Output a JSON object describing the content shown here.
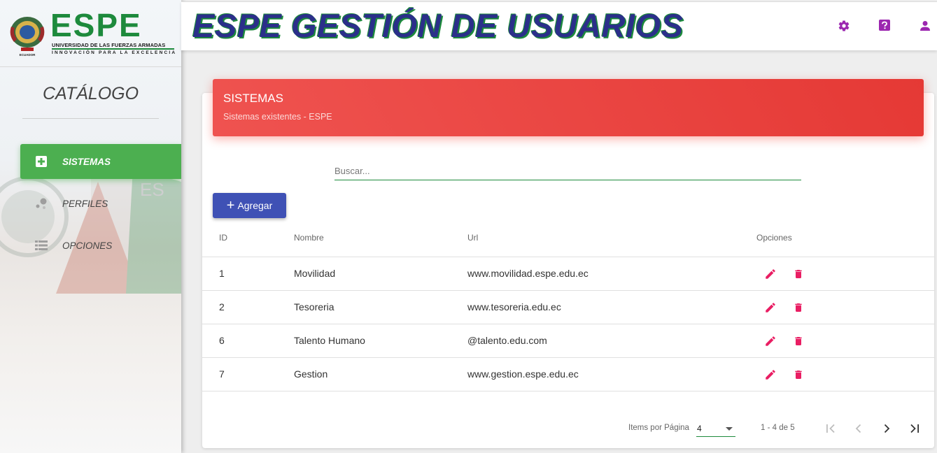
{
  "brand": {
    "logo_word": "ESPE",
    "logo_line1": "UNIVERSIDAD DE LAS FUERZAS ARMADAS",
    "logo_line2": "INNOVACIÓN PARA LA EXCELENCIA",
    "shield_text": "ECUADOR"
  },
  "header": {
    "title": "ESPE GESTIÓN DE USUARIOS",
    "icons": [
      "gear-icon",
      "help-icon",
      "user-icon"
    ]
  },
  "sidebar": {
    "section_title": "CATÁLOGO",
    "items": [
      {
        "label": "SISTEMAS",
        "icon": "plus-box-icon",
        "active": true
      },
      {
        "label": "PERFILES",
        "icon": "bubbles-icon",
        "active": false
      },
      {
        "label": "OPCIONES",
        "icon": "list-icon",
        "active": false
      }
    ]
  },
  "card": {
    "title": "SISTEMAS",
    "subtitle": "Sistemas existentes - ESPE"
  },
  "search": {
    "placeholder": "Buscar...",
    "value": ""
  },
  "add_button": {
    "label": "Agregar"
  },
  "table": {
    "columns": [
      "ID",
      "Nombre",
      "Url",
      "Opciones"
    ],
    "rows": [
      {
        "id": "1",
        "nombre": "Movilidad",
        "url": "www.movilidad.espe.edu.ec"
      },
      {
        "id": "2",
        "nombre": "Tesoreria",
        "url": "www.tesoreria.edu.ec"
      },
      {
        "id": "6",
        "nombre": "Talento Humano",
        "url": "@talento.edu.com"
      },
      {
        "id": "7",
        "nombre": "Gestion",
        "url": "www.gestion.espe.edu.ec"
      }
    ]
  },
  "paginator": {
    "items_label": "Items por Página",
    "page_size": "4",
    "range": "1 - 4 de 5"
  },
  "colors": {
    "accent_green": "#4caf50",
    "header_red": "#e53935",
    "primary_blue": "#3f51b5",
    "action_pink": "#e91e63",
    "topbar_icon_purple": "#9c27b0"
  }
}
